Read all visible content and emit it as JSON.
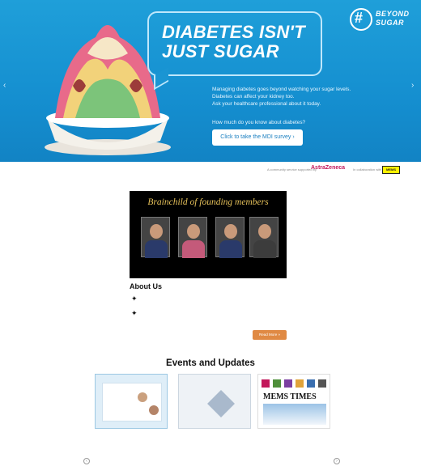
{
  "hero": {
    "headline_1": "DIABETES ISN'T",
    "headline_2": "JUST SUGAR",
    "logo_word_1": "BEYOND",
    "logo_word_2": "SUGAR",
    "copy_1": "Managing diabetes goes beyond watching your sugar levels.",
    "copy_2": "Diabetes can affect your kidney too.",
    "copy_3": "Ask your healthcare professional about it today.",
    "question": "How much do you know about diabetes?",
    "cta_label": "Click to take the MDI survey ›",
    "prev": "‹",
    "next": "›",
    "colors": {
      "background": "#1894d3",
      "accent": "#ffffff"
    }
  },
  "infobar": {
    "sponsor_label": "A community service supported by",
    "sponsor_name": "AstraZeneca",
    "org_label": "In collaboration with",
    "org_logo": "MEMS"
  },
  "founders": {
    "title": "Brainchild of founding members"
  },
  "about": {
    "heading": "About Us",
    "read_more": "Read More »"
  },
  "events": {
    "heading": "Events and Updates",
    "mems_times": "MEMS TIMES",
    "prev": "‹",
    "next": "›"
  }
}
